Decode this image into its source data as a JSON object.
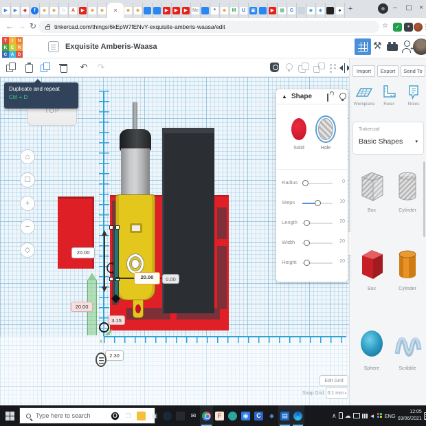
{
  "colors": {
    "accent_blue": "#4a90d9",
    "solid_red": "#d81f33",
    "tinkercad_red": "#e01f26",
    "hole_stripe": "#b9b9b9"
  },
  "browser": {
    "active_tab_index": 11,
    "active_tab_close": "×",
    "url": "tinkercad.com/things/6kEpW7fENvY-exquisite-amberis-waasa/edit",
    "tabs": [
      {
        "name": "pointer-blue-1",
        "ch": "▶",
        "fg": "#4a7fd4",
        "bg": "#fff"
      },
      {
        "name": "pointer-blue-2",
        "ch": "▶",
        "fg": "#4a7fd4",
        "bg": "#fff"
      },
      {
        "name": "game-red",
        "ch": "◆",
        "fg": "#d93b2f",
        "bg": "#fff"
      },
      {
        "name": "facebook",
        "ch": "f",
        "fg": "#fff",
        "bg": "#1877f2",
        "round": true
      },
      {
        "name": "profile-yellow-1",
        "ch": "☻",
        "fg": "#e2a33a",
        "bg": "#fff"
      },
      {
        "name": "profile-yellow-2",
        "ch": "☻",
        "fg": "#e2a33a",
        "bg": "#fff"
      },
      {
        "name": "diamond-silver",
        "ch": "◇",
        "fg": "#8fb4d8",
        "bg": "#fff"
      },
      {
        "name": "letter-a",
        "ch": "A",
        "fg": "#e8483f",
        "bg": "#fff"
      },
      {
        "name": "youtube-1",
        "ch": "▶",
        "fg": "#fff",
        "bg": "#e62117"
      },
      {
        "name": "profile-yellow-3",
        "ch": "☻",
        "fg": "#e2a33a",
        "bg": "#fff"
      },
      {
        "name": "profile-yellow-4",
        "ch": "☻",
        "fg": "#e2a33a",
        "bg": "#fff"
      },
      {
        "name": "tinkercad-active",
        "ch": "",
        "fg": "",
        "bg": ""
      },
      {
        "name": "profile-yellow-5",
        "ch": "☻",
        "fg": "#e2a33a",
        "bg": "#fff"
      },
      {
        "name": "profile-yellow-6",
        "ch": "☻",
        "fg": "#e2a33a",
        "bg": "#fff"
      },
      {
        "name": "blue-square-1",
        "ch": "",
        "fg": "#fff",
        "bg": "#2787f5"
      },
      {
        "name": "blue-square-2",
        "ch": "",
        "fg": "#fff",
        "bg": "#2787f5"
      },
      {
        "name": "youtube-2",
        "ch": "▶",
        "fg": "#fff",
        "bg": "#e62117"
      },
      {
        "name": "youtube-3",
        "ch": "▶",
        "fg": "#fff",
        "bg": "#e62117"
      },
      {
        "name": "youtube-4",
        "ch": "▶",
        "fg": "#fff",
        "bg": "#e62117"
      },
      {
        "name": "ne-site",
        "ch": "Ne",
        "fg": "#9aa0a6",
        "bg": "#fff"
      },
      {
        "name": "blue-square-3",
        "ch": "",
        "fg": "#fff",
        "bg": "#2787f5"
      },
      {
        "name": "dark-asterisk",
        "ch": "*",
        "fg": "#333",
        "bg": "#fff"
      },
      {
        "name": "profile-yellow-7",
        "ch": "☻",
        "fg": "#e2a33a",
        "bg": "#fff"
      },
      {
        "name": "letter-m-green",
        "ch": "M",
        "fg": "#3aa857",
        "bg": "#fff"
      },
      {
        "name": "letter-u-blue",
        "ch": "U",
        "fg": "#2b6fd4",
        "bg": "#fff"
      },
      {
        "name": "blue-3d-square",
        "ch": "▣",
        "fg": "#fff",
        "bg": "#2787f5"
      },
      {
        "name": "blue-square-4",
        "ch": "",
        "fg": "#fff",
        "bg": "#2787f5"
      },
      {
        "name": "youtube-5",
        "ch": "▶",
        "fg": "#fff",
        "bg": "#e62117"
      },
      {
        "name": "chart-green",
        "ch": "▦",
        "fg": "#3aa857",
        "bg": "#fff"
      },
      {
        "name": "google",
        "ch": "G",
        "fg": "#4285f4",
        "bg": "#fff"
      },
      {
        "name": "grey-blob",
        "ch": "",
        "fg": "#fff",
        "bg": "#cdd6df"
      },
      {
        "name": "diamond-blue-1",
        "ch": "◆",
        "fg": "#4aa3e0",
        "bg": "#fff"
      },
      {
        "name": "diamond-blue-2",
        "ch": "◆",
        "fg": "#4aa3e0",
        "bg": "#fff"
      },
      {
        "name": "dark-rect",
        "ch": "",
        "fg": "#fff",
        "bg": "#222"
      },
      {
        "name": "spade-dark",
        "ch": "♠",
        "fg": "#222",
        "bg": "#fff"
      }
    ]
  },
  "icons": {
    "back": "←",
    "forward": "→",
    "reload": "↻",
    "star": "☆",
    "menu": "⋮",
    "check": "✓",
    "newtab": "+",
    "minimize": "–",
    "maximize": "▢",
    "close": "×",
    "undo": "↶",
    "redo": "↷",
    "pickaxe": "⚒",
    "nav_home": "⌂",
    "nav_fit": "☐",
    "nav_zoom_in": "+",
    "nav_zoom_out": "−",
    "nav_persp": "◇",
    "panel_collapse": "›",
    "caret_down": "▾",
    "tri_up": "▲",
    "tray_chevron": "∧",
    "tray_cloud": "☁",
    "tray_volume": "◄",
    "mail": "✉"
  },
  "header": {
    "title": "Exquisite Amberis-Waasa",
    "logo_cells": [
      {
        "ch": "T",
        "bg": "#e44d42"
      },
      {
        "ch": "I",
        "bg": "#f3b23a"
      },
      {
        "ch": "N",
        "bg": "#ef7f31"
      },
      {
        "ch": "K",
        "bg": "#45a649"
      },
      {
        "ch": "E",
        "bg": "#c3cf34"
      },
      {
        "ch": "R",
        "bg": "#f0a03a"
      },
      {
        "ch": "C",
        "bg": "#3b6fb5"
      },
      {
        "ch": "A",
        "bg": "#41b8e4"
      },
      {
        "ch": "D",
        "bg": "#e44d42"
      }
    ]
  },
  "tooltip": {
    "label": "Duplicate and repeat",
    "shortcut": "Ctrl + D"
  },
  "viewcube": {
    "top": "TOP"
  },
  "dimensions": {
    "ruler_height": "20.00",
    "segment_width": "20.00",
    "segment_depth": "0.00",
    "plate_height": "20.00",
    "gap": "3.15",
    "axis_offset": "2.30",
    "axis_label": "x"
  },
  "shape_panel": {
    "title": "Shape",
    "solid": "Solid",
    "hole": "Hole",
    "sliders": [
      {
        "label": "Radius",
        "value": "0"
      },
      {
        "label": "Steps",
        "value": "10"
      },
      {
        "label": "Length",
        "value": "20"
      },
      {
        "label": "Width",
        "value": "20"
      },
      {
        "label": "Height",
        "value": "20"
      }
    ]
  },
  "right_panel": {
    "import": "Import",
    "export": "Export",
    "send_to": "Send To",
    "workplane": "Workplane",
    "ruler": "Ruler",
    "notes": "Notes",
    "library_brand": "Tinkercad",
    "library_selected": "Basic Shapes",
    "gallery": [
      {
        "label": "Box"
      },
      {
        "label": "Cylinder"
      },
      {
        "label": "Box"
      },
      {
        "label": "Cylinder"
      },
      {
        "label": "Sphere"
      },
      {
        "label": "Scribble"
      }
    ]
  },
  "grid_controls": {
    "edit": "Edit Grid",
    "snap_label": "Snap Grid",
    "snap_value": "0.1 mm"
  },
  "taskbar": {
    "search": "Type here to search",
    "lang": "ENG",
    "time": "12:05",
    "date": "03/06/2021",
    "apps": [
      {
        "name": "opera",
        "ch": "O",
        "fg": "#e8eaec",
        "bg": "#101417",
        "round": true,
        "bd": "#e8eaec"
      },
      {
        "name": "task-view",
        "ch": "❒",
        "fg": "#c8d0d8",
        "bg": ""
      },
      {
        "name": "file-explorer",
        "ch": "",
        "fg": "",
        "bg": "#f6c13a"
      },
      {
        "name": "ms-store",
        "ch": "▣",
        "fg": "#e8eaec",
        "bg": ""
      },
      {
        "name": "steam",
        "ch": "",
        "fg": "#c7d5e0",
        "bg": "#1b2838",
        "round": true
      },
      {
        "name": "msi-app",
        "ch": "",
        "fg": "",
        "bg": "#26292d"
      },
      {
        "name": "mail",
        "ch": "✉",
        "fg": "#d8e6f2",
        "bg": ""
      },
      {
        "name": "chrome",
        "ch": "",
        "fg": "",
        "bg": "",
        "cls": "chrome",
        "active": true
      },
      {
        "name": "f-app",
        "ch": "F",
        "fg": "#e2574c",
        "bg": "#f5e9dc"
      },
      {
        "name": "teal-app",
        "ch": "",
        "fg": "",
        "bg": "#2aa7a0",
        "round": true
      },
      {
        "name": "meet",
        "ch": "◉",
        "fg": "#fff",
        "bg": "#2b7de9"
      },
      {
        "name": "c-app",
        "ch": "C",
        "fg": "#fff",
        "bg": "#2b66c3"
      },
      {
        "name": "diamond-app",
        "ch": "◆",
        "fg": "#5a7cc0",
        "bg": ""
      },
      {
        "name": "outlook",
        "ch": "▤",
        "fg": "#fff",
        "bg": "#1868c5",
        "active": true
      },
      {
        "name": "edge",
        "ch": "",
        "fg": "",
        "bg": "",
        "cls": "edge",
        "active": true
      }
    ]
  }
}
